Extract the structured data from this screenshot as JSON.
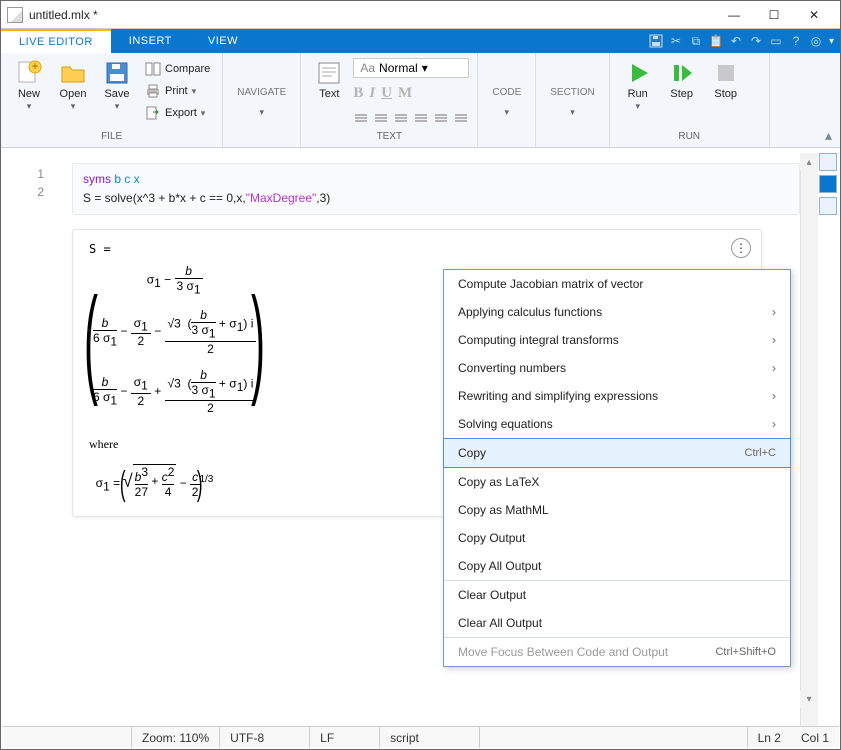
{
  "window": {
    "title": "untitled.mlx *"
  },
  "tabs": {
    "live_editor": "LIVE EDITOR",
    "insert": "INSERT",
    "view": "VIEW"
  },
  "ribbon": {
    "file": {
      "new": "New",
      "open": "Open",
      "save": "Save",
      "compare": "Compare",
      "print": "Print",
      "export": "Export",
      "label": "FILE"
    },
    "navigate": {
      "title": "NAVIGATE"
    },
    "text": {
      "button": "Text",
      "style_prefix": "Aa",
      "style": "Normal",
      "label": "TEXT"
    },
    "code": {
      "title": "CODE"
    },
    "section": {
      "title": "SECTION"
    },
    "run": {
      "run": "Run",
      "step": "Step",
      "stop": "Stop",
      "label": "RUN"
    }
  },
  "code": {
    "lineNumbers": [
      "1",
      "2"
    ],
    "line1_kw": "syms ",
    "line1_vars": "b c x",
    "line2_a": "S = solve(x^3 + b*x + c == 0,x,",
    "line2_str": "\"MaxDegree\"",
    "line2_b": ",3)"
  },
  "output": {
    "lhs": "S =",
    "where": "where"
  },
  "context_menu": {
    "items": [
      {
        "label": "Compute Jacobian matrix of vector",
        "sub": false
      },
      {
        "label": "Applying calculus functions",
        "sub": true
      },
      {
        "label": "Computing integral transforms",
        "sub": true
      },
      {
        "label": "Converting numbers",
        "sub": true
      },
      {
        "label": "Rewriting and simplifying expressions",
        "sub": true
      },
      {
        "label": "Solving equations",
        "sub": true
      }
    ],
    "copy": {
      "label": "Copy",
      "accel": "Ctrl+C"
    },
    "copy_latex": "Copy as LaTeX",
    "copy_mathml": "Copy as MathML",
    "copy_output": "Copy Output",
    "copy_all_output": "Copy All Output",
    "clear_output": "Clear Output",
    "clear_all_output": "Clear All Output",
    "move_focus": {
      "label": "Move Focus Between Code and Output",
      "accel": "Ctrl+Shift+O"
    }
  },
  "status": {
    "zoom": "Zoom: 110%",
    "enc": "UTF-8",
    "eol": "LF",
    "type": "script",
    "line": "Ln  2",
    "col": "Col  1"
  }
}
